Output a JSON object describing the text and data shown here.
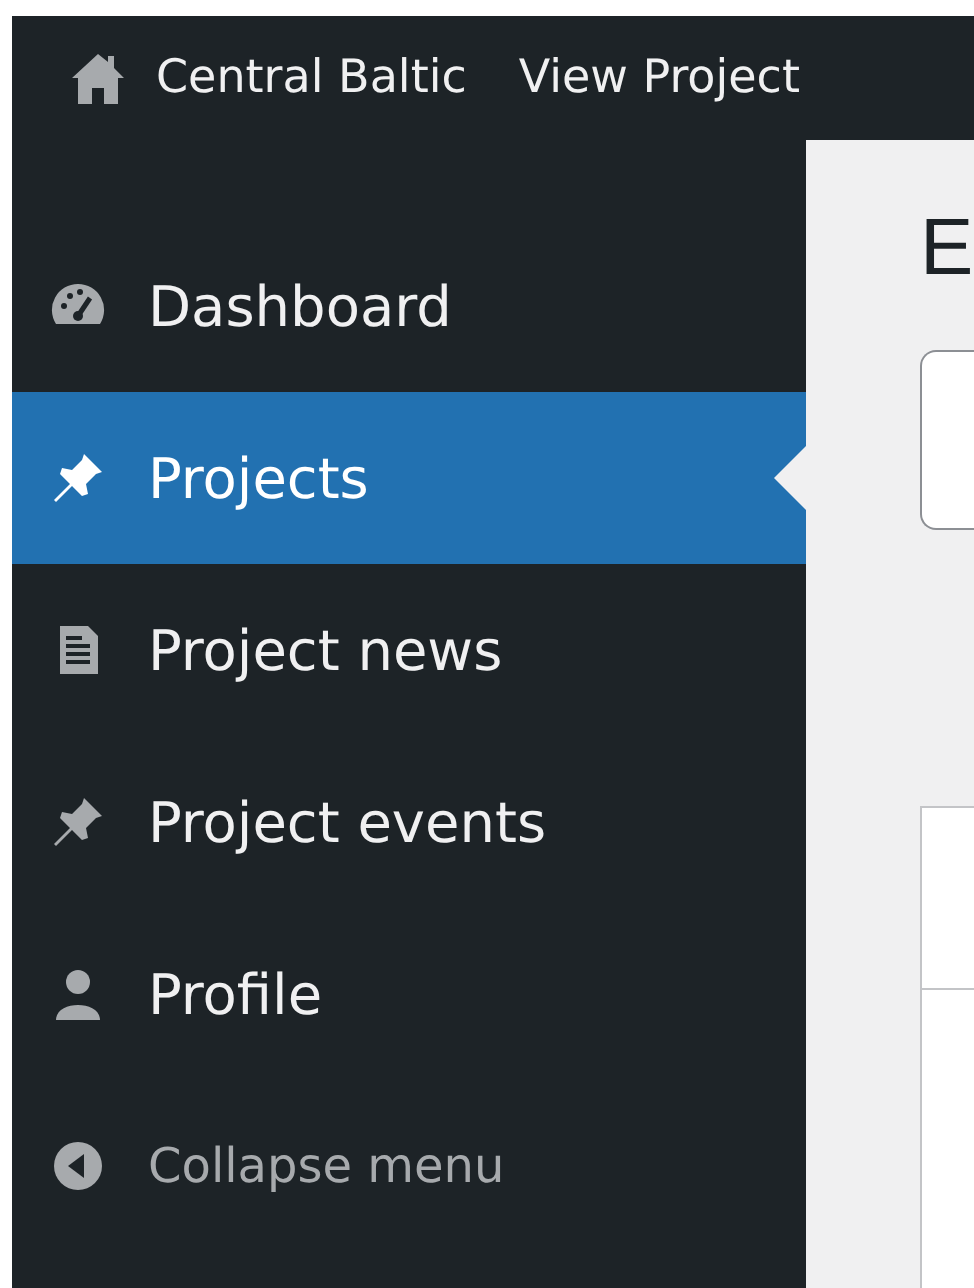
{
  "admin_bar": {
    "items": [
      {
        "kind": "site",
        "label": "Central Baltic"
      },
      {
        "kind": "link",
        "label": "View Project"
      }
    ]
  },
  "sidebar": {
    "items": [
      {
        "kind": "gauge",
        "label": "Dashboard",
        "selected": false
      },
      {
        "kind": "pin",
        "label": "Projects",
        "selected": true
      },
      {
        "kind": "document",
        "label": "Project news",
        "selected": false
      },
      {
        "kind": "pin",
        "label": "Project events",
        "selected": false
      },
      {
        "kind": "person",
        "label": "Profile",
        "selected": false
      }
    ],
    "collapse": {
      "label": "Collapse menu"
    }
  },
  "content": {
    "heading": "E"
  }
}
